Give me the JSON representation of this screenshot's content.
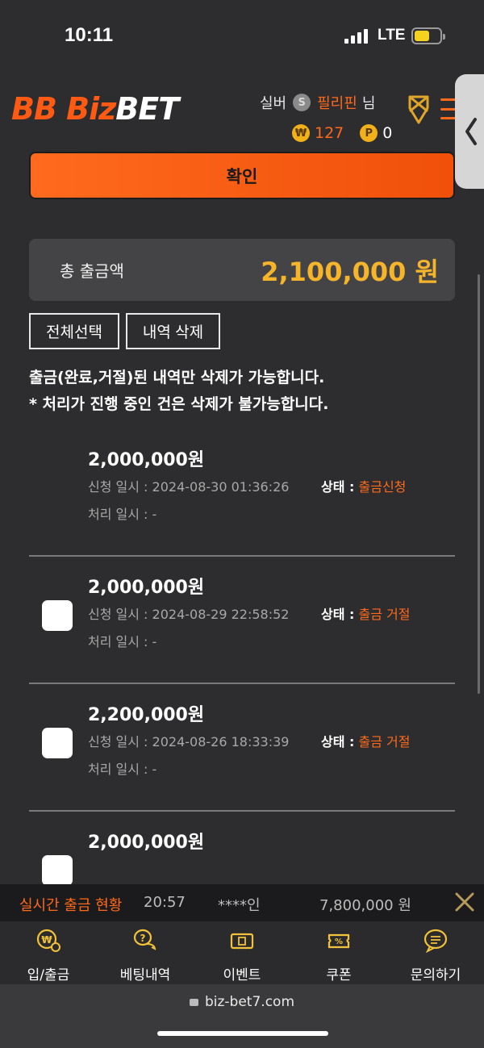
{
  "status_bar": {
    "time": "10:11",
    "network": "LTE"
  },
  "header": {
    "logo_biz": "BB Biz",
    "logo_bet": "BET",
    "rank": "실버",
    "rank_badge": "S",
    "user_name": "필리핀",
    "honorific": "님",
    "money_badge": "₩",
    "money": "127",
    "point_badge": "P",
    "points": "0"
  },
  "confirm_label": "확인",
  "total": {
    "label": "총 출금액",
    "value": "2,100,000 원"
  },
  "buttons": {
    "select_all": "전체선택",
    "delete_history": "내역 삭제"
  },
  "notice": {
    "line1": "출금(완료,거절)된 내역만 삭제가 가능합니다.",
    "line2": "* 처리가 진행 중인 건은 삭제가 불가능합니다."
  },
  "withdrawals": [
    {
      "amount": "2,000,000원",
      "request": "신청 일시 : 2024-08-30 01:36:26",
      "processed": "처리 일시 : -",
      "status_label": "상태 :",
      "status": "출금신청",
      "checkbox": false
    },
    {
      "amount": "2,000,000원",
      "request": "신청 일시 : 2024-08-29 22:58:52",
      "processed": "처리 일시 : -",
      "status_label": "상태 :",
      "status": "출금 거절",
      "checkbox": true
    },
    {
      "amount": "2,200,000원",
      "request": "신청 일시 : 2024-08-26 18:33:39",
      "processed": "처리 일시 : -",
      "status_label": "상태 :",
      "status": "출금 거절",
      "checkbox": true
    },
    {
      "amount": "2,000,000원",
      "checkbox": true
    }
  ],
  "ticker": {
    "label": "실시간 출금 현황",
    "time": "20:57",
    "user": "****인",
    "amount": "7,800,000 원"
  },
  "nav": [
    {
      "label": "입/출금",
      "icon": "deposit-withdraw-icon"
    },
    {
      "label": "베팅내역",
      "icon": "betting-history-icon"
    },
    {
      "label": "이벤트",
      "icon": "event-icon"
    },
    {
      "label": "쿠폰",
      "icon": "coupon-icon"
    },
    {
      "label": "문의하기",
      "icon": "inquiry-icon"
    }
  ],
  "url": "biz-bet7.com",
  "colors": {
    "accent": "#ff6a1a",
    "total_value": "#f6b42a",
    "background": "#2d2d2f"
  }
}
